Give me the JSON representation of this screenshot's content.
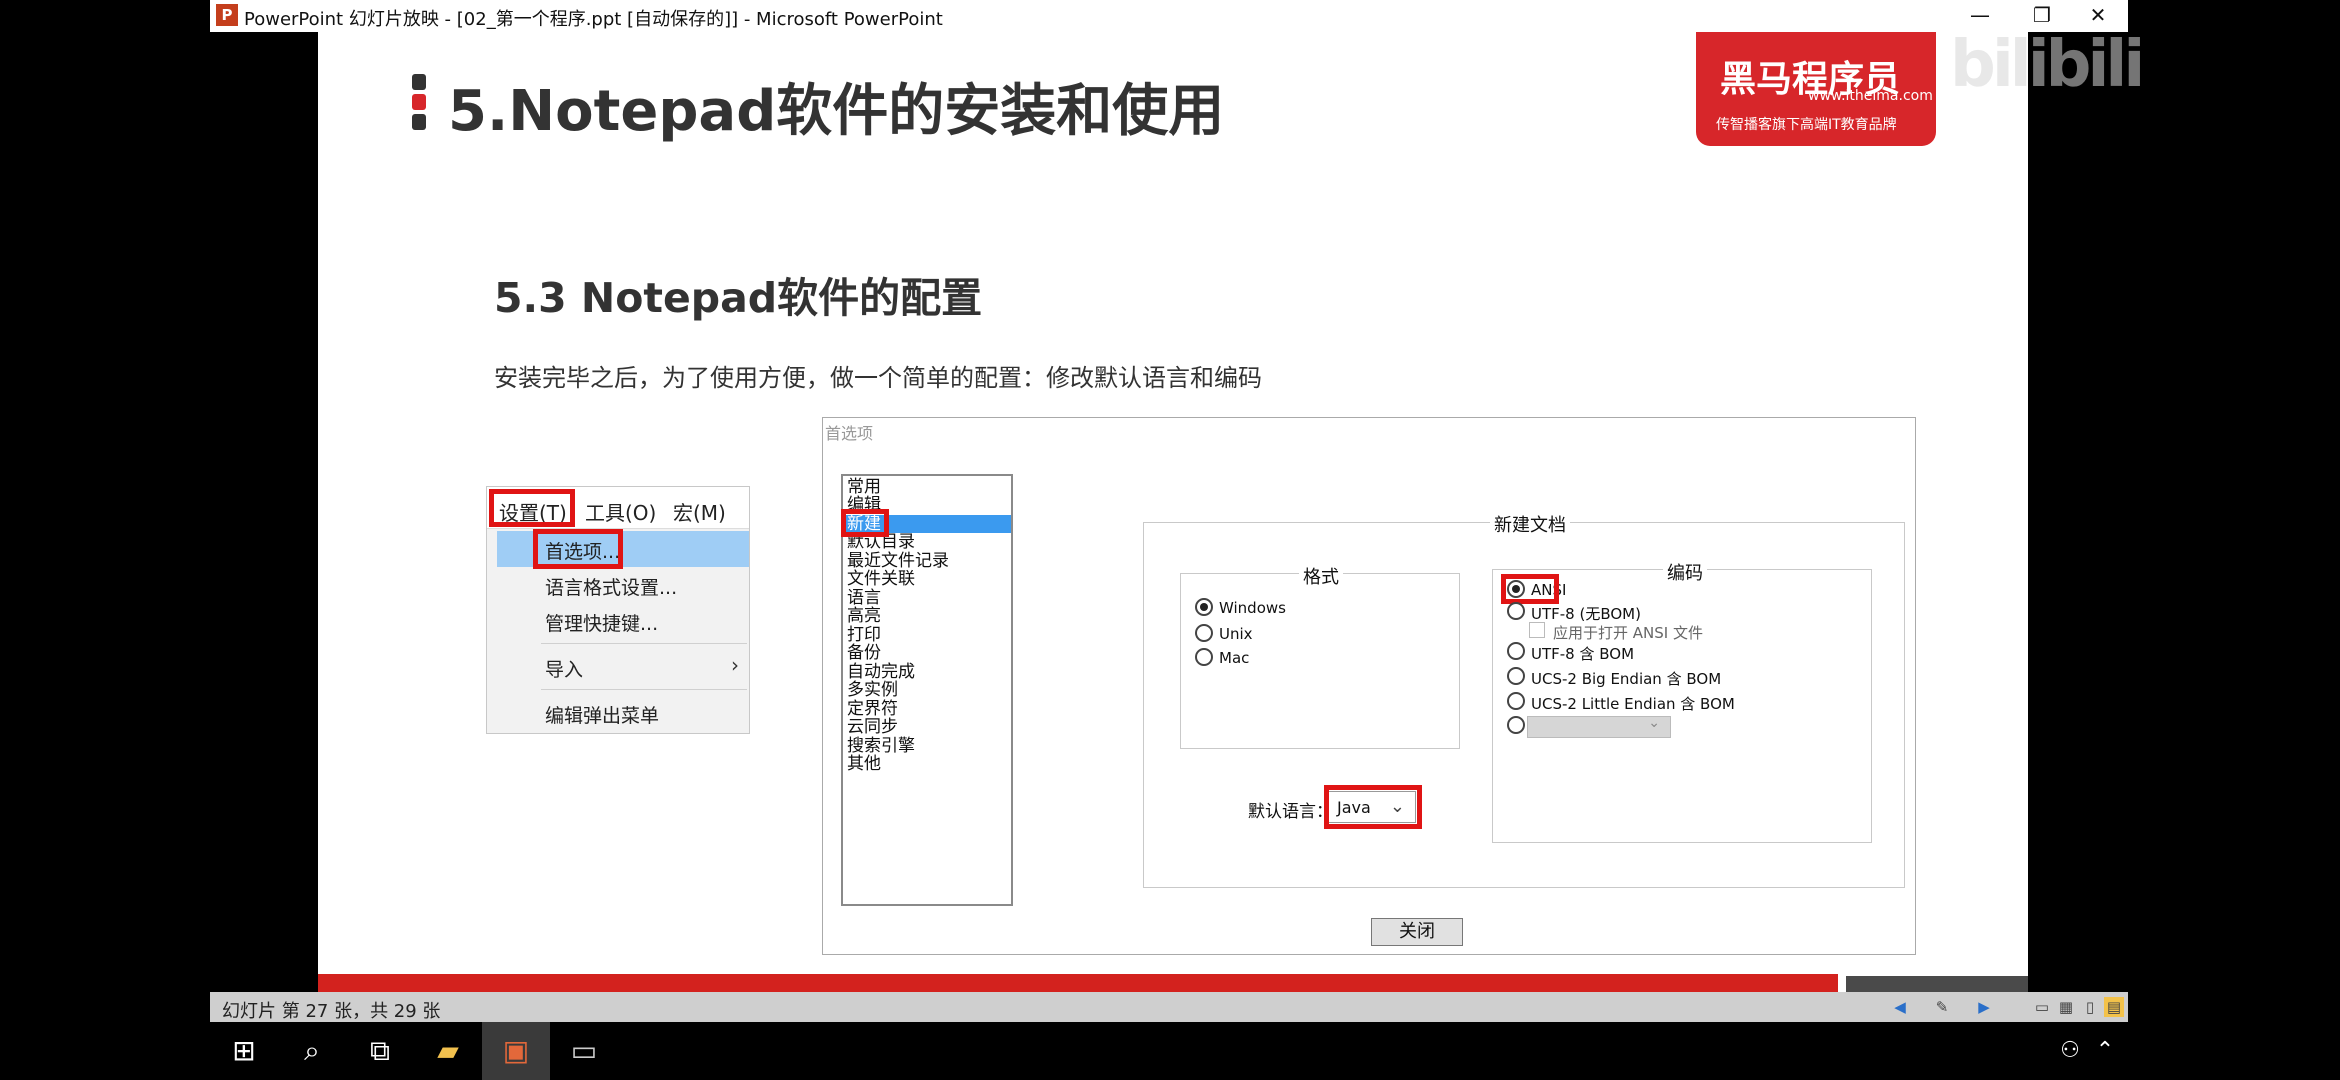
{
  "window": {
    "title": "PowerPoint 幻灯片放映 - [02_第一个程序.ppt [自动保存的]] - Microsoft PowerPoint",
    "app_icon": "P",
    "controls": {
      "minimize": "—",
      "restore": "❐",
      "close": "✕"
    }
  },
  "slide": {
    "main_title": "5.Notepad软件的安装和使用",
    "sub_title": "5.3 Notepad软件的配置",
    "description": "安装完毕之后，为了使用方便，做一个简单的配置：修改默认语言和编码",
    "logo": {
      "main": "黑马程序员",
      "url": "www.itheima.com",
      "slogan": "传智播客旗下高端IT教育品牌"
    },
    "menu": {
      "bar": [
        "设置(T)",
        "工具(O)",
        "宏(M)"
      ],
      "items": [
        "首选项...",
        "语言格式设置...",
        "管理快捷键...",
        "导入",
        "编辑弹出菜单"
      ],
      "submenu_arrow": "›"
    },
    "dialog": {
      "title": "首选项",
      "categories": [
        "常用",
        "编辑",
        "新建",
        "默认目录",
        "最近文件记录",
        "文件关联",
        "语言",
        "高亮",
        "打印",
        "备份",
        "自动完成",
        "多实例",
        "定界符",
        "云同步",
        "搜索引擎",
        "其他"
      ],
      "new_doc_label": "新建文档",
      "format_label": "格式",
      "format_options": [
        "Windows",
        "Unix",
        "Mac"
      ],
      "encoding_label": "编码",
      "encoding_options": [
        "ANSI",
        "UTF-8 (无BOM)",
        "UTF-8 含 BOM",
        "UCS-2 Big Endian 含 BOM",
        "UCS-2 Little Endian 含 BOM"
      ],
      "apply_ansi_label": "应用于打开 ANSI 文件",
      "default_language_label": "默认语言：",
      "default_language_value": "Java",
      "close_button": "关闭"
    }
  },
  "status": {
    "slide_info": "幻灯片 第 27 张，共 29 张"
  },
  "watermark": "bilibili",
  "colors": {
    "accent_red": "#d7262a",
    "highlight_box": "#e01414",
    "selection_blue": "#3b9aef"
  }
}
